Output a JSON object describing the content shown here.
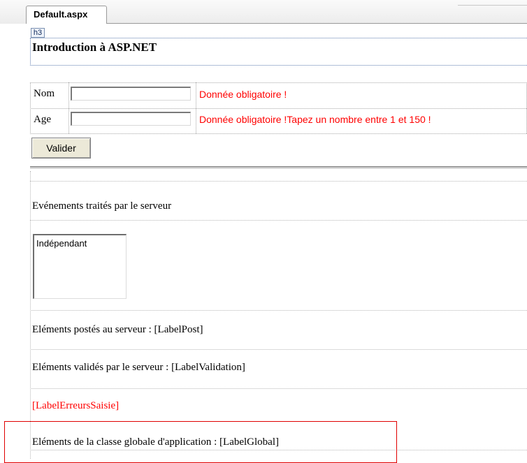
{
  "tab": {
    "label": "Default.aspx"
  },
  "heading": {
    "tag": "h3",
    "title": "Introduction à ASP.NET"
  },
  "form": {
    "rows": [
      {
        "label": "Nom",
        "value": "",
        "error": "Donnée obligatoire !"
      },
      {
        "label": "Age",
        "value": "",
        "error": "Donnée obligatoire !Tapez un nombre entre 1 et 150 !"
      }
    ],
    "submit_label": "Valider"
  },
  "events": {
    "label": "Evénements traités par le serveur",
    "list_items": [
      "Indépendant"
    ]
  },
  "labels": {
    "posted": "Eléments postés au serveur : [LabelPost]",
    "validated": "Eléments validés par le serveur : [LabelValidation]",
    "errors": "[LabelErreursSaisie]",
    "global": "Eléments de la classe globale d'application : [LabelGlobal]"
  },
  "colors": {
    "error": "#ff0000",
    "highlight": "#e00000"
  }
}
